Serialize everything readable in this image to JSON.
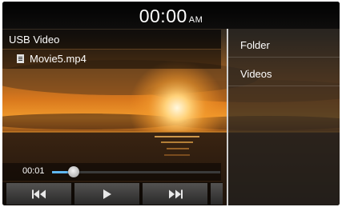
{
  "clock": {
    "time": "00:00",
    "ampm": "AM"
  },
  "player": {
    "source": "USB Video",
    "file_name": "Movie5.mp4",
    "elapsed": "00:01",
    "progress": 0.13
  },
  "menu": {
    "items": [
      {
        "label": "Folder"
      },
      {
        "label": "Videos"
      }
    ]
  },
  "icons": {
    "file": "file-icon",
    "previous": "skip-previous-icon",
    "play": "play-icon",
    "next": "skip-next-icon"
  },
  "colors": {
    "accent": "#5fb7f2",
    "sun": "#ffd27a",
    "sky_top": "#1f1f22",
    "sky_glow": "#e07f1f"
  }
}
